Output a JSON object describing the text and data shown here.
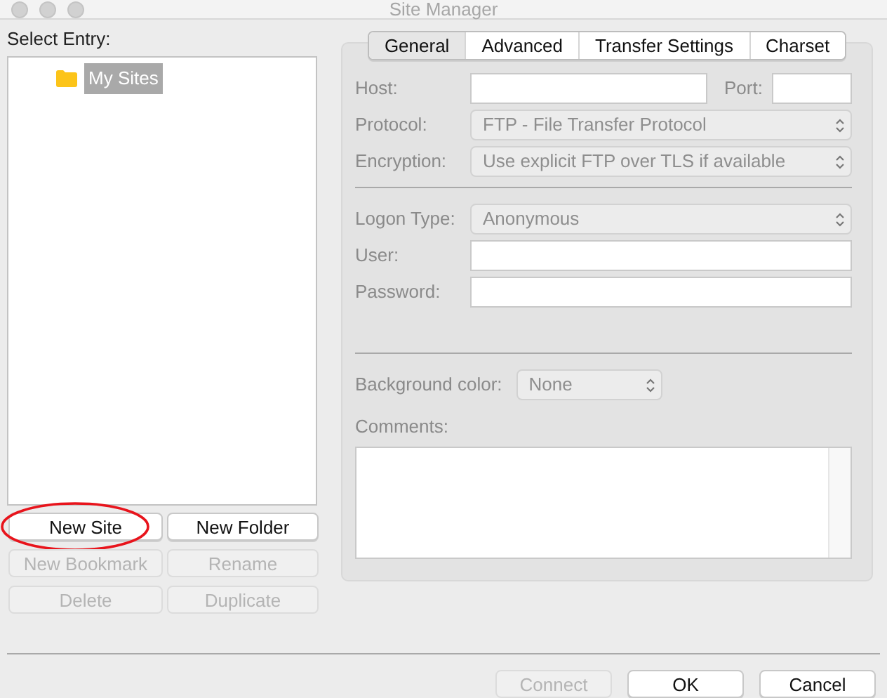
{
  "window": {
    "title": "Site Manager"
  },
  "select_entry_label": "Select Entry:",
  "tree": [
    {
      "label": "My Sites",
      "kind": "folder",
      "selected": true
    }
  ],
  "entry_buttons": [
    {
      "label": "New Site",
      "disabled": false,
      "circled": true
    },
    {
      "label": "New Folder",
      "disabled": false,
      "circled": false
    },
    {
      "label": "New Bookmark",
      "disabled": true,
      "circled": false
    },
    {
      "label": "Rename",
      "disabled": true,
      "circled": false
    },
    {
      "label": "Delete",
      "disabled": true,
      "circled": false
    },
    {
      "label": "Duplicate",
      "disabled": true,
      "circled": false
    }
  ],
  "tabs": [
    {
      "label": "General",
      "selected": true
    },
    {
      "label": "Advanced",
      "selected": false
    },
    {
      "label": "Transfer Settings",
      "selected": false
    },
    {
      "label": "Charset",
      "selected": false
    }
  ],
  "general": {
    "server_fields": [
      {
        "label": "Host:",
        "kind": "text",
        "disabled": true,
        "extra": {
          "label": "Port:"
        }
      },
      {
        "label": "Protocol:",
        "kind": "select",
        "value": "FTP - File Transfer Protocol",
        "disabled": true
      },
      {
        "label": "Encryption:",
        "kind": "select",
        "value": "Use explicit FTP over TLS if available",
        "disabled": true
      }
    ],
    "logon_fields": [
      {
        "label": "Logon Type:",
        "kind": "select",
        "value": "Anonymous",
        "disabled": true
      },
      {
        "label": "User:",
        "kind": "text",
        "disabled": true
      },
      {
        "label": "Password:",
        "kind": "text",
        "disabled": true
      }
    ],
    "background_color": {
      "label": "Background color:",
      "value": "None",
      "disabled": true
    },
    "comments": {
      "label": "Comments:",
      "disabled": true
    }
  },
  "dialog_buttons": [
    {
      "label": "Connect",
      "disabled": true
    },
    {
      "label": "OK",
      "disabled": false
    },
    {
      "label": "Cancel",
      "disabled": false
    }
  ]
}
